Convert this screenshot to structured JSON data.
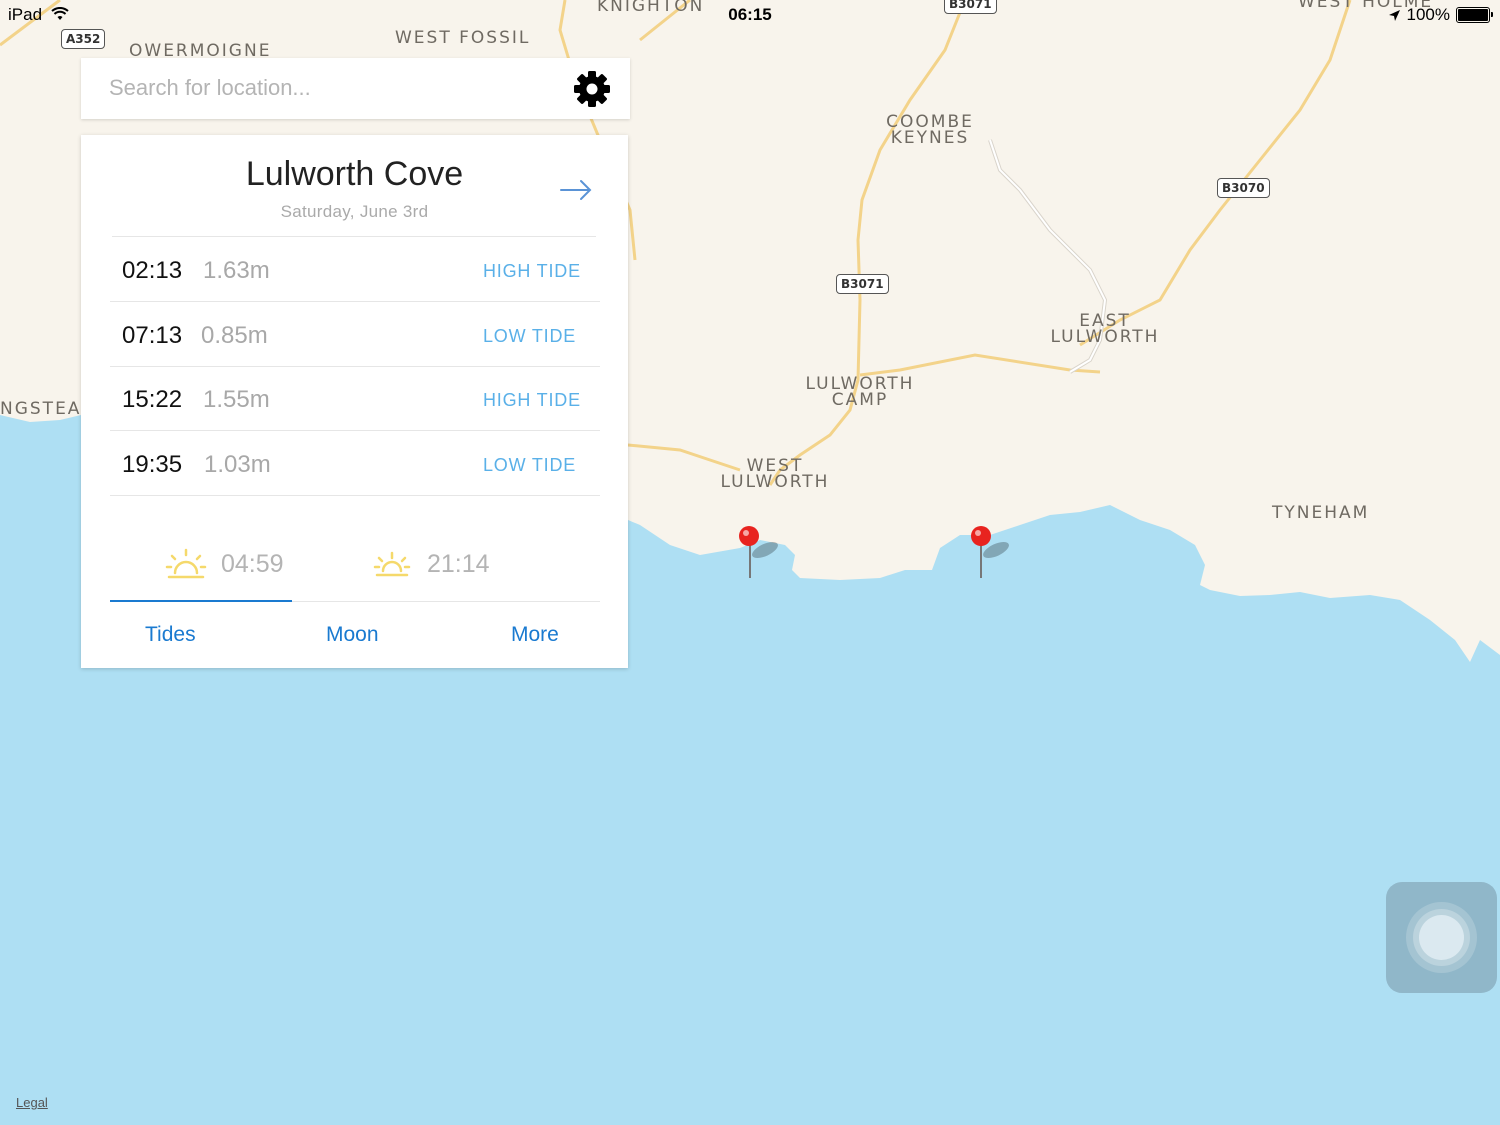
{
  "status_bar": {
    "device": "iPad",
    "time": "06:15",
    "battery": "100%",
    "battery_level": 1.0
  },
  "map": {
    "places": [
      {
        "id": "knighton",
        "name": "Knighton"
      },
      {
        "id": "west-fossil",
        "name": "West Fossil"
      },
      {
        "id": "owermoigne",
        "name": "Owermoigne"
      },
      {
        "id": "coombe-keynes",
        "name": "Coombe Keynes"
      },
      {
        "id": "east-lulworth",
        "name": "East Lulworth"
      },
      {
        "id": "lulworth-camp",
        "name": "Lulworth Camp"
      },
      {
        "id": "west-lulworth",
        "name": "West Lulworth"
      },
      {
        "id": "tyneham",
        "name": "Tyneham"
      },
      {
        "id": "west-holme",
        "name": "West Holme"
      },
      {
        "id": "ngstead",
        "name": "ngstead"
      }
    ],
    "roads": [
      "A352",
      "B3071",
      "B3071",
      "B3070"
    ],
    "legal_label": "Legal",
    "colors": {
      "land": "#f8f4ec",
      "water": "#aedff3",
      "road": "#f3d38a",
      "pin": "#e8231f"
    }
  },
  "search": {
    "placeholder": "Search for location...",
    "value": ""
  },
  "settings_icon": "gear-icon",
  "card": {
    "location": "Lulworth Cove",
    "date": "Saturday, June 3rd",
    "tides": [
      {
        "time": "02:13",
        "height": "1.63m",
        "type": "HIGH TIDE"
      },
      {
        "time": "07:13",
        "height": "0.85m",
        "type": "LOW TIDE"
      },
      {
        "time": "15:22",
        "height": "1.55m",
        "type": "HIGH TIDE"
      },
      {
        "time": "19:35",
        "height": "1.03m",
        "type": "LOW TIDE"
      }
    ],
    "sunrise": "04:59",
    "sunset": "21:14",
    "tabs": [
      "Tides",
      "Moon",
      "More"
    ],
    "active_tab": "Tides",
    "accent_color": "#1a7ad0",
    "tide_type_color": "#5ab0e8",
    "sun_color": "#f5d96b"
  }
}
